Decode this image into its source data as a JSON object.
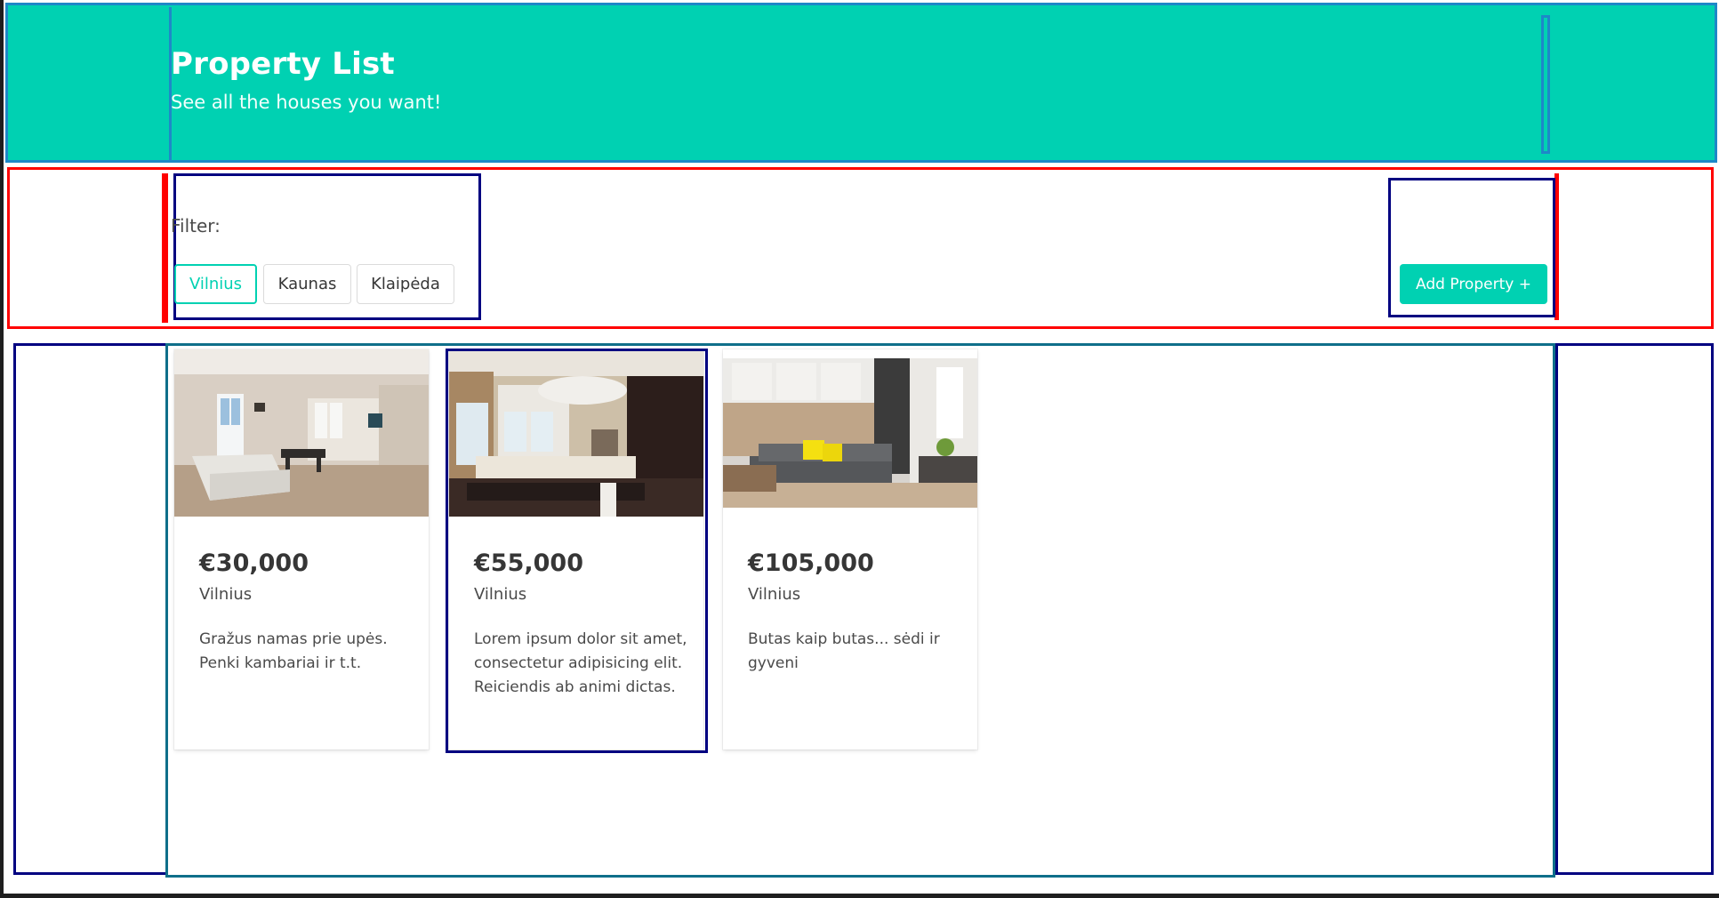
{
  "header": {
    "title": "Property List",
    "subtitle": "See all the houses you want!"
  },
  "filter": {
    "label": "Filter:",
    "options": [
      "Vilnius",
      "Kaunas",
      "Klaipėda"
    ],
    "selected": "Vilnius"
  },
  "actions": {
    "add_property_label": "Add Property +"
  },
  "properties": [
    {
      "price": "€30,000",
      "city": "Vilnius",
      "description": "Gražus namas prie upės. Penki kambariai ir t.t.",
      "image": "living-room-with-white-sofa-photo"
    },
    {
      "price": "€55,000",
      "city": "Vilnius",
      "description": "Lorem ipsum dolor sit amet, consectetur adipisicing elit. Reiciendis ab animi dictas.",
      "image": "living-room-with-dining-table-photo"
    },
    {
      "price": "€105,000",
      "city": "Vilnius",
      "description": "Butas kaip butas... sėdi ir gyveni",
      "image": "studio-with-grey-sofa-yellow-pillows-photo"
    }
  ],
  "colors": {
    "primary": "#00d1b2",
    "text": "#4a4a4a",
    "heading": "#363636"
  }
}
